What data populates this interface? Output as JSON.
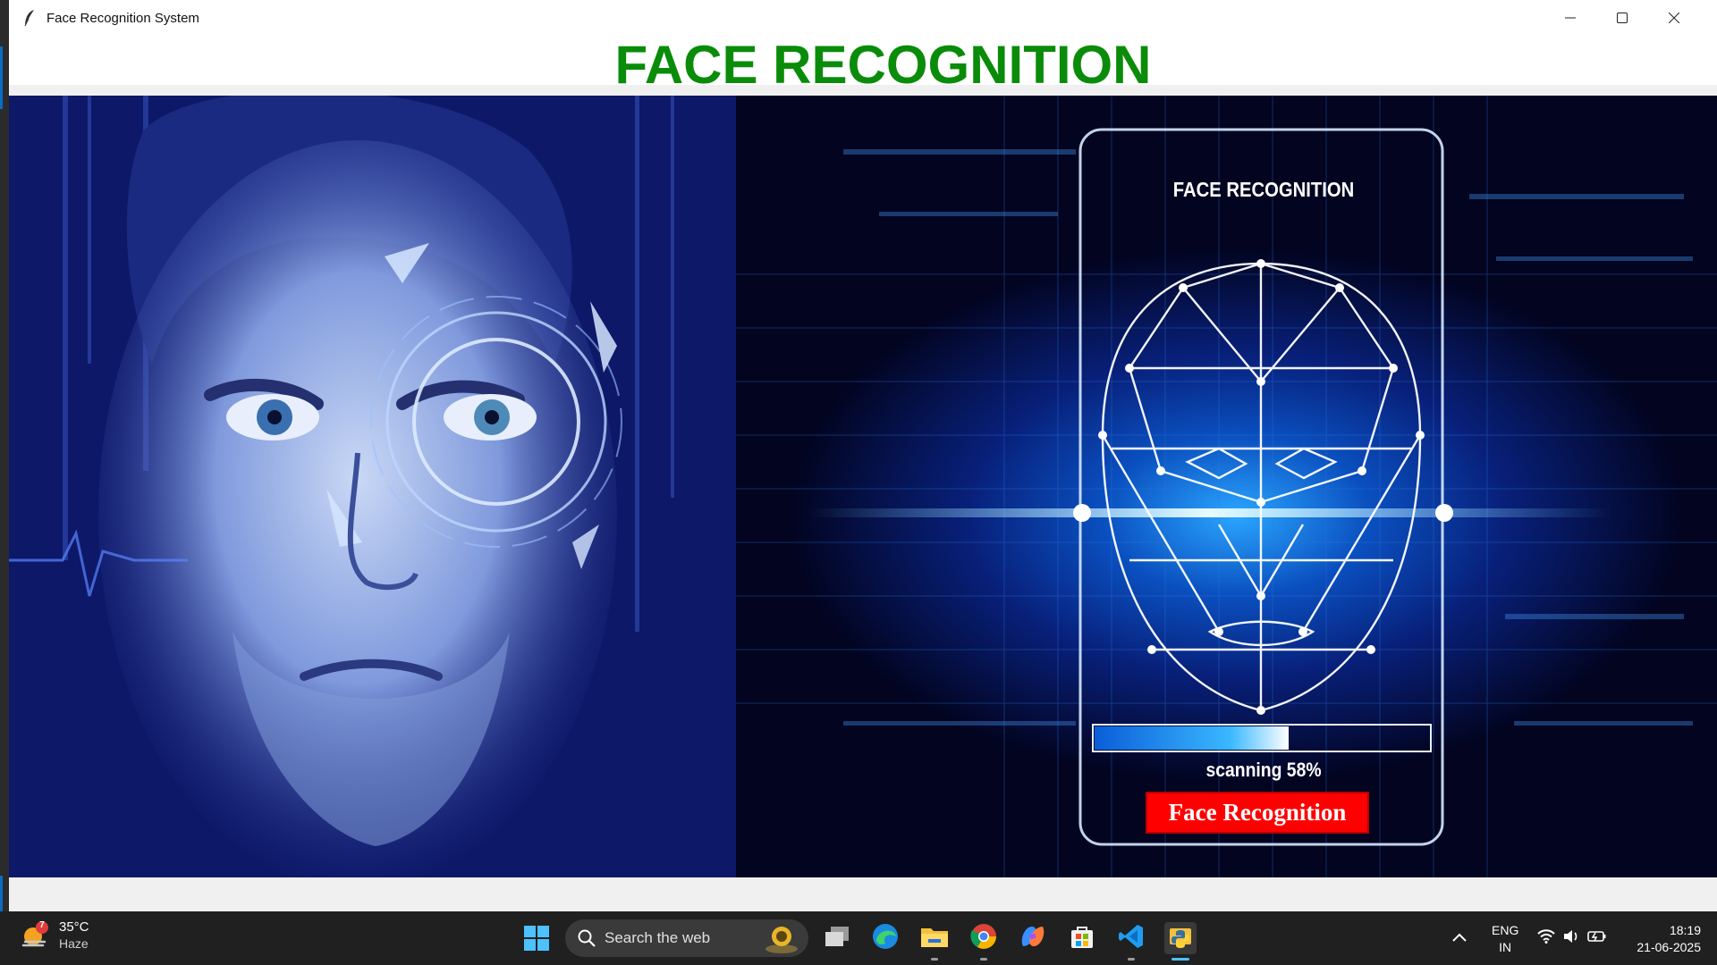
{
  "window": {
    "title": "Face Recognition System"
  },
  "header": {
    "heading": "FACE RECOGNITION"
  },
  "scan_panel": {
    "title": "FACE RECOGNITION",
    "status": "scanning 58%",
    "progress": 0.58,
    "button_label": "Face Recognition"
  },
  "taskbar": {
    "weather": {
      "temp": "35°C",
      "desc": "Haze",
      "badge": "7"
    },
    "search_placeholder": "Search the web",
    "language": {
      "line1": "ENG",
      "line2": "IN"
    },
    "clock": {
      "time": "18:19",
      "date": "21-06-2025"
    }
  },
  "colors": {
    "heading_green": "#0a8c0a",
    "button_red": "#ff0000",
    "taskbar_bg": "#202020"
  },
  "icons": [
    "feather-app-icon",
    "minimize-icon",
    "maximize-icon",
    "close-icon",
    "weather-icon",
    "windows-start-icon",
    "search-icon",
    "task-view-icon",
    "edge-icon",
    "file-explorer-icon",
    "chrome-icon",
    "copilot-icon",
    "store-icon",
    "vscode-icon",
    "python-app-icon",
    "chevron-up-icon",
    "wifi-icon",
    "volume-icon",
    "battery-icon"
  ]
}
